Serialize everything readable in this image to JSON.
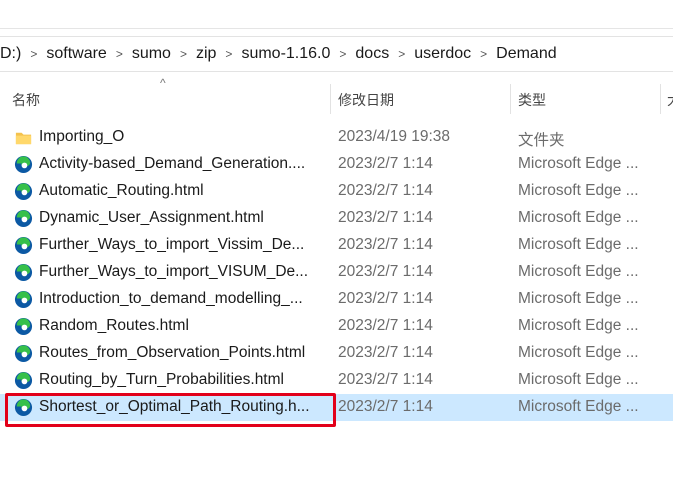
{
  "breadcrumb": [
    "D:)",
    "software",
    "sumo",
    "zip",
    "sumo-1.16.0",
    "docs",
    "userdoc",
    "Demand"
  ],
  "breadcrumb_separator": ">",
  "sort_indicator": "^",
  "columns": {
    "name": "名称",
    "date": "修改日期",
    "type": "类型",
    "size": "大"
  },
  "files": [
    {
      "name": "Importing_O",
      "date": "2023/4/19 19:38",
      "type": "文件夹",
      "icon": "folder-icon",
      "selected": false
    },
    {
      "name": "Activity-based_Demand_Generation....",
      "date": "2023/2/7 1:14",
      "type": "Microsoft Edge ...",
      "icon": "edge-icon",
      "selected": false
    },
    {
      "name": "Automatic_Routing.html",
      "date": "2023/2/7 1:14",
      "type": "Microsoft Edge ...",
      "icon": "edge-icon",
      "selected": false
    },
    {
      "name": "Dynamic_User_Assignment.html",
      "date": "2023/2/7 1:14",
      "type": "Microsoft Edge ...",
      "icon": "edge-icon",
      "selected": false
    },
    {
      "name": "Further_Ways_to_import_Vissim_De...",
      "date": "2023/2/7 1:14",
      "type": "Microsoft Edge ...",
      "icon": "edge-icon",
      "selected": false
    },
    {
      "name": "Further_Ways_to_import_VISUM_De...",
      "date": "2023/2/7 1:14",
      "type": "Microsoft Edge ...",
      "icon": "edge-icon",
      "selected": false
    },
    {
      "name": "Introduction_to_demand_modelling_...",
      "date": "2023/2/7 1:14",
      "type": "Microsoft Edge ...",
      "icon": "edge-icon",
      "selected": false
    },
    {
      "name": "Random_Routes.html",
      "date": "2023/2/7 1:14",
      "type": "Microsoft Edge ...",
      "icon": "edge-icon",
      "selected": false
    },
    {
      "name": "Routes_from_Observation_Points.html",
      "date": "2023/2/7 1:14",
      "type": "Microsoft Edge ...",
      "icon": "edge-icon",
      "selected": false
    },
    {
      "name": "Routing_by_Turn_Probabilities.html",
      "date": "2023/2/7 1:14",
      "type": "Microsoft Edge ...",
      "icon": "edge-icon",
      "selected": false
    },
    {
      "name": "Shortest_or_Optimal_Path_Routing.h...",
      "date": "2023/2/7 1:14",
      "type": "Microsoft Edge ...",
      "icon": "edge-icon",
      "selected": true
    }
  ],
  "colors": {
    "selection": "#cce8ff",
    "highlight": "#e2001a",
    "folder": "#f4c24d",
    "edge_blue": "#0c59a4",
    "edge_green": "#36c04a"
  }
}
